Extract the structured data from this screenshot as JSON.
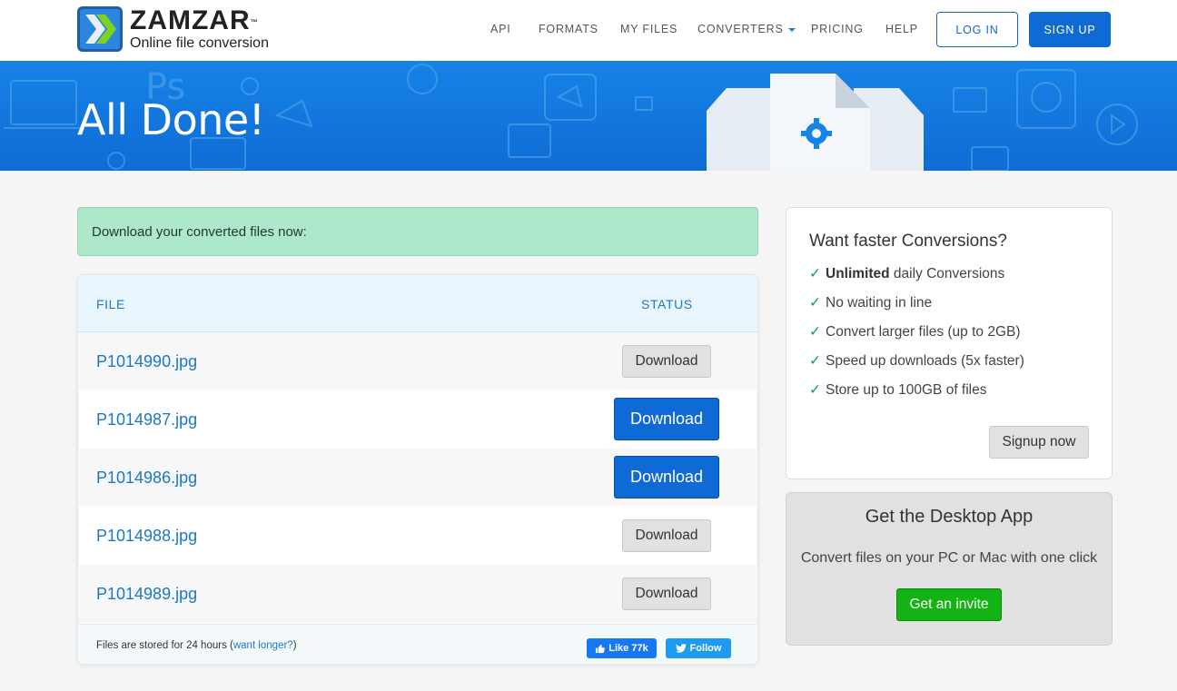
{
  "brand": {
    "name": "ZAMZAR",
    "trademark": "™",
    "tagline": "Online file conversion"
  },
  "nav": {
    "items": [
      "API",
      "FORMATS",
      "MY FILES",
      "CONVERTERS",
      "PRICING",
      "HELP"
    ],
    "login": "LOG IN",
    "signup": "SIGN UP"
  },
  "banner": {
    "title": "All Done!"
  },
  "alert": {
    "text": "Download your converted files now:"
  },
  "table": {
    "headers": {
      "file": "FILE",
      "status": "STATUS"
    },
    "rows": [
      {
        "file": "P1014990.jpg",
        "action": "Download",
        "style": "gray"
      },
      {
        "file": "P1014987.jpg",
        "action": "Download",
        "style": "blue"
      },
      {
        "file": "P1014986.jpg",
        "action": "Download",
        "style": "blue"
      },
      {
        "file": "P1014988.jpg",
        "action": "Download",
        "style": "gray"
      },
      {
        "file": "P1014989.jpg",
        "action": "Download",
        "style": "gray"
      }
    ],
    "footer": {
      "note_prefix": "Files are stored for 24 hours (",
      "note_link": "want longer?",
      "note_suffix": ")",
      "like": "Like 77k",
      "follow": "Follow"
    }
  },
  "upsell": {
    "title": "Want faster Conversions?",
    "check": "✓",
    "benefits": [
      {
        "bold": "Unlimited",
        "text": " daily Conversions"
      },
      {
        "bold": "",
        "text": "No waiting in line"
      },
      {
        "bold": "",
        "text": "Convert larger files (up to 2GB)"
      },
      {
        "bold": "",
        "text": "Speed up downloads (5x faster)"
      },
      {
        "bold": "",
        "text": "Store up to 100GB of files"
      }
    ],
    "button": "Signup now"
  },
  "desktop": {
    "title": "Get the Desktop App",
    "subtitle": "Convert files on your PC or Mac with one click",
    "button": "Get an invite"
  },
  "colors": {
    "brand_blue": "#0f6ad6",
    "banner_blue": "#1683e6",
    "alert_green": "#aee8cb",
    "invite_green": "#14b314",
    "check_green": "#1a9e4a"
  }
}
